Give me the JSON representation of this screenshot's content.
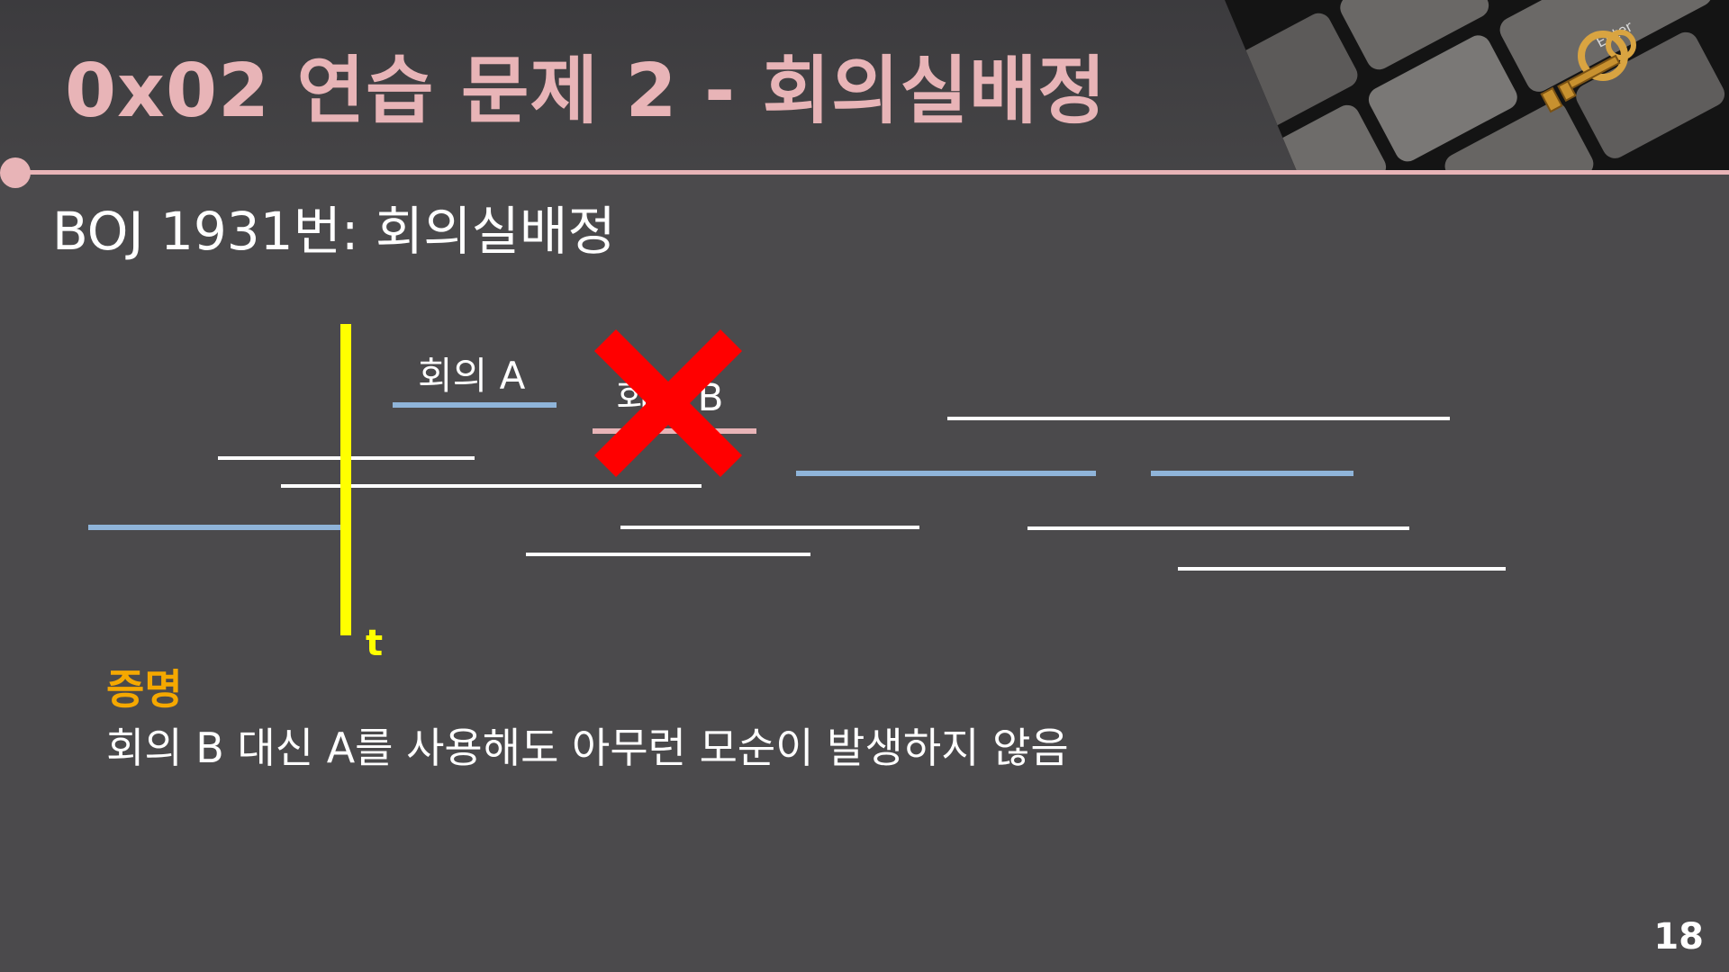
{
  "header": {
    "title": "0x02  연습 문제 2 - 회의실배정"
  },
  "subtitle": "BOJ 1931번: 회의실배정",
  "diagram": {
    "meeting_a_label": "회의 A",
    "meeting_b_label": "회의 B",
    "time_marker_label": "t",
    "colors": {
      "selected": "#8fb4d9",
      "other": "#ffffff",
      "excluded": "#e8b4b7",
      "time_marker": "#ffff00",
      "cross": "#ff0000"
    }
  },
  "proof": {
    "label": "증명",
    "text": "회의 B 대신 A를 사용해도 아무런 모순이 발생하지 않음"
  },
  "page_number": "18"
}
